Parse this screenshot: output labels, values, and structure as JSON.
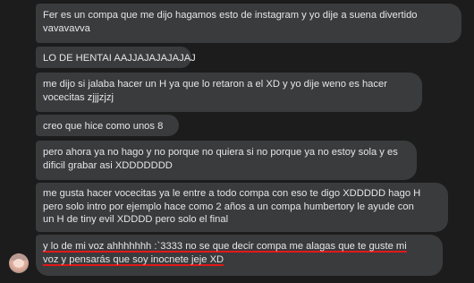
{
  "messages": [
    {
      "lines": [
        "Fer es un compa que me dijo hagamos esto de instagram y  yo dije a suena divertido",
        "vavavavva"
      ]
    },
    {
      "lines": [
        "LO DE HENTAI AAJJAJAJAJAJAJ"
      ]
    },
    {
      "lines": [
        "me dijo si jalaba hacer un H ya que lo retaron a el XD y yo dije weno es hacer",
        "vocecitas zjjjzjzj"
      ]
    },
    {
      "lines": [
        "creo que hice como unos 8"
      ]
    },
    {
      "lines": [
        "pero ahora ya no hago y no porque no quiera si no porque ya no estoy sola y es",
        "dificil grabar asi XDDDDDDD"
      ]
    },
    {
      "lines": [
        "me gusta hacer vocecitas ya le entre a todo compa con eso te digo XDDDDD hago H",
        "pero solo intro por ejemplo hace como 2 años a un compa humbertory le ayude con",
        "un H de tiny evil XDDDD pero solo el final"
      ]
    },
    {
      "lines": [
        "y lo de mi voz ahhhhhhh :`3333 no se que decir compa me alagas que te guste mi",
        "voz y pensarás que soy inocnete jeje XD"
      ]
    }
  ],
  "colors": {
    "background": "#1c1c1d",
    "bubble": "#3a3b3c",
    "text": "#e4e6eb",
    "underline": "#e0191b"
  }
}
